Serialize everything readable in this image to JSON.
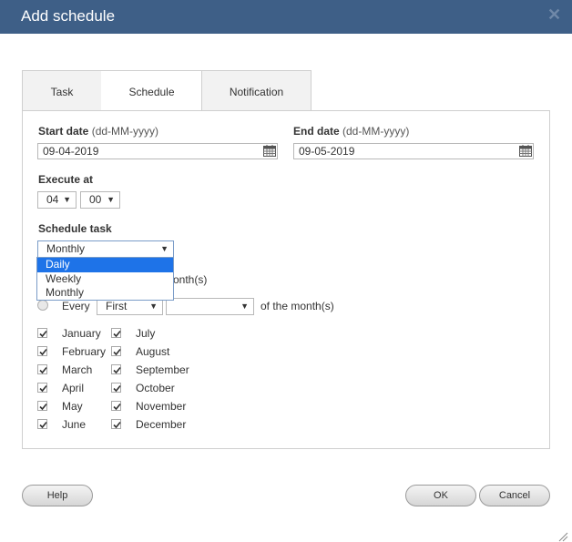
{
  "dialog": {
    "title": "Add schedule",
    "close_glyph": "✕"
  },
  "tabs": [
    "Task",
    "Schedule",
    "Notification"
  ],
  "start_date": {
    "label": "Start date",
    "hint": "(dd-MM-yyyy)",
    "value": "09-04-2019"
  },
  "end_date": {
    "label": "End date",
    "hint": "(dd-MM-yyyy)",
    "value": "09-05-2019"
  },
  "execute_at": {
    "label": "Execute at",
    "hour": "04",
    "minute": "00"
  },
  "schedule_task": {
    "label": "Schedule task",
    "selected": "Monthly",
    "options": [
      "Daily",
      "Weekly",
      "Monthly"
    ],
    "highlighted": "Daily"
  },
  "monthly": {
    "partial_text": "onth(s)",
    "every_label": "Every",
    "every_select": "First",
    "day_select": "",
    "of_month_text": "of the month(s)"
  },
  "months": {
    "left": [
      "January",
      "February",
      "March",
      "April",
      "May",
      "June"
    ],
    "right": [
      "July",
      "August",
      "September",
      "October",
      "November",
      "December"
    ]
  },
  "buttons": {
    "help": "Help",
    "ok": "OK",
    "cancel": "Cancel"
  },
  "icons": {
    "calendar": "calendar-icon",
    "close": "close-icon",
    "checkbox": "checkmark-icon",
    "resize": "resize-grip-icon"
  },
  "colors": {
    "titlebar": "#3e5f87",
    "highlight": "#1e73e8"
  }
}
